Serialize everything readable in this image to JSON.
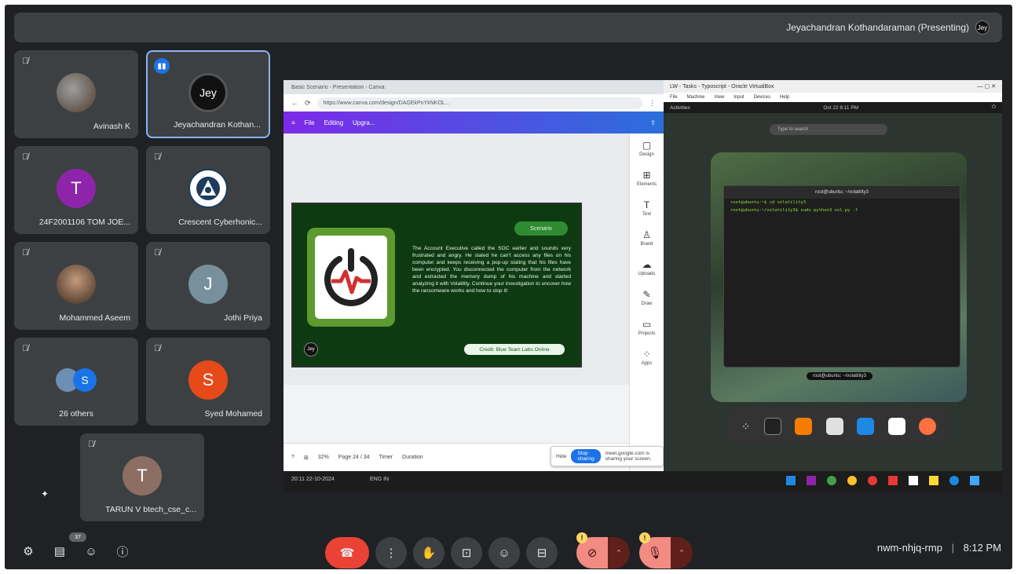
{
  "header": {
    "presenter_label": "Jeyachandran Kothandaraman (Presenting)",
    "presenter_initials": "Jey"
  },
  "tiles": [
    {
      "name": "Avinash K",
      "avatar_letter": "",
      "avatar_color": "#5a4a3a",
      "type": "photo"
    },
    {
      "name": "Jeyachandran Kothan...",
      "avatar_letter": "Jey",
      "avatar_color": "#111111",
      "type": "logo",
      "speaking": true
    },
    {
      "name": "24F2001106 TOM JOE...",
      "avatar_letter": "T",
      "avatar_color": "#8e24aa",
      "type": "letter"
    },
    {
      "name": "Crescent Cyberhonic...",
      "avatar_letter": "",
      "avatar_color": "#ffffff",
      "type": "emblem"
    },
    {
      "name": "Mohammed Aseem",
      "avatar_letter": "",
      "avatar_color": "#6b4a33",
      "type": "photo"
    },
    {
      "name": "Jothi Priya",
      "avatar_letter": "J",
      "avatar_color": "#78909c",
      "type": "letter"
    },
    {
      "name": "26 others",
      "avatar_letter": "S",
      "avatar_color": "#1a73e8",
      "type": "group"
    },
    {
      "name": "Syed Mohamed",
      "avatar_letter": "S",
      "avatar_color": "#e64a19",
      "type": "letter"
    },
    {
      "name": "TARUN V btech_cse_c...",
      "avatar_letter": "T",
      "avatar_color": "#8d6e63",
      "type": "letter"
    }
  ],
  "shared_screen": {
    "browser": {
      "tab_title": "Basic Scenario - Presentation - Canva",
      "url": "https://www.canva.com/design/DAGEkPnYkNKOL..."
    },
    "canva": {
      "menu_file": "File",
      "menu_editing": "Editing",
      "menu_upgrade": "Upgra...",
      "sidebar": [
        "Design",
        "Elements",
        "Text",
        "Brand",
        "Uploads",
        "Draw",
        "Projects",
        "Apps"
      ],
      "status_items": [
        "Duration",
        "Timer",
        "Page 24 / 34",
        "32%"
      ],
      "stop_sharing_text": "meet.google.com is sharing your screen.",
      "stop_sharing_button": "Stop sharing",
      "hide_button": "Hide"
    },
    "slide": {
      "pill": "Scenario",
      "body": "The Account Executive called the SOC earlier and sounds very frustrated and angry. He stated he can't access any files on his computer and keeps receiving a pop-up stating that his files have been encrypted. You disconnected the computer from the network and extracted the memory dump of his machine and started analyzing it with Volatility. Continue your investigation to uncover how the ransomware works and how to stop it!",
      "credit": "Credit: Blue Team Labs Online",
      "badge": "Jey"
    },
    "thumbs": [
      "",
      "",
      "",
      "",
      "",
      ""
    ],
    "vm": {
      "title": "LW - Tasks - Typoscript - Oracle VirtualBox",
      "menu": [
        "File",
        "Machine",
        "View",
        "Input",
        "Devices",
        "Help"
      ],
      "topbar_left": "Activities",
      "topbar_clock": "Oct 22 8:11 PM",
      "search": "Type to search",
      "terminal_title": "root@ubuntu: ~/volatility3",
      "terminal_lines": [
        "root@ubuntu:~$ cd volatility3",
        "root@ubuntu:~/volatility3$ sudo python3 vol.py -f"
      ],
      "desktop_label": "root@ubuntu: ~/volatility3"
    },
    "taskbar": {
      "lang": "ENG IN",
      "time": "20:11",
      "date": "22-10-2024"
    }
  },
  "bottom": {
    "time": "8:12 PM",
    "separator": "|",
    "meeting_code": "nwm-nhjq-rmp",
    "participant_badge": "37"
  }
}
